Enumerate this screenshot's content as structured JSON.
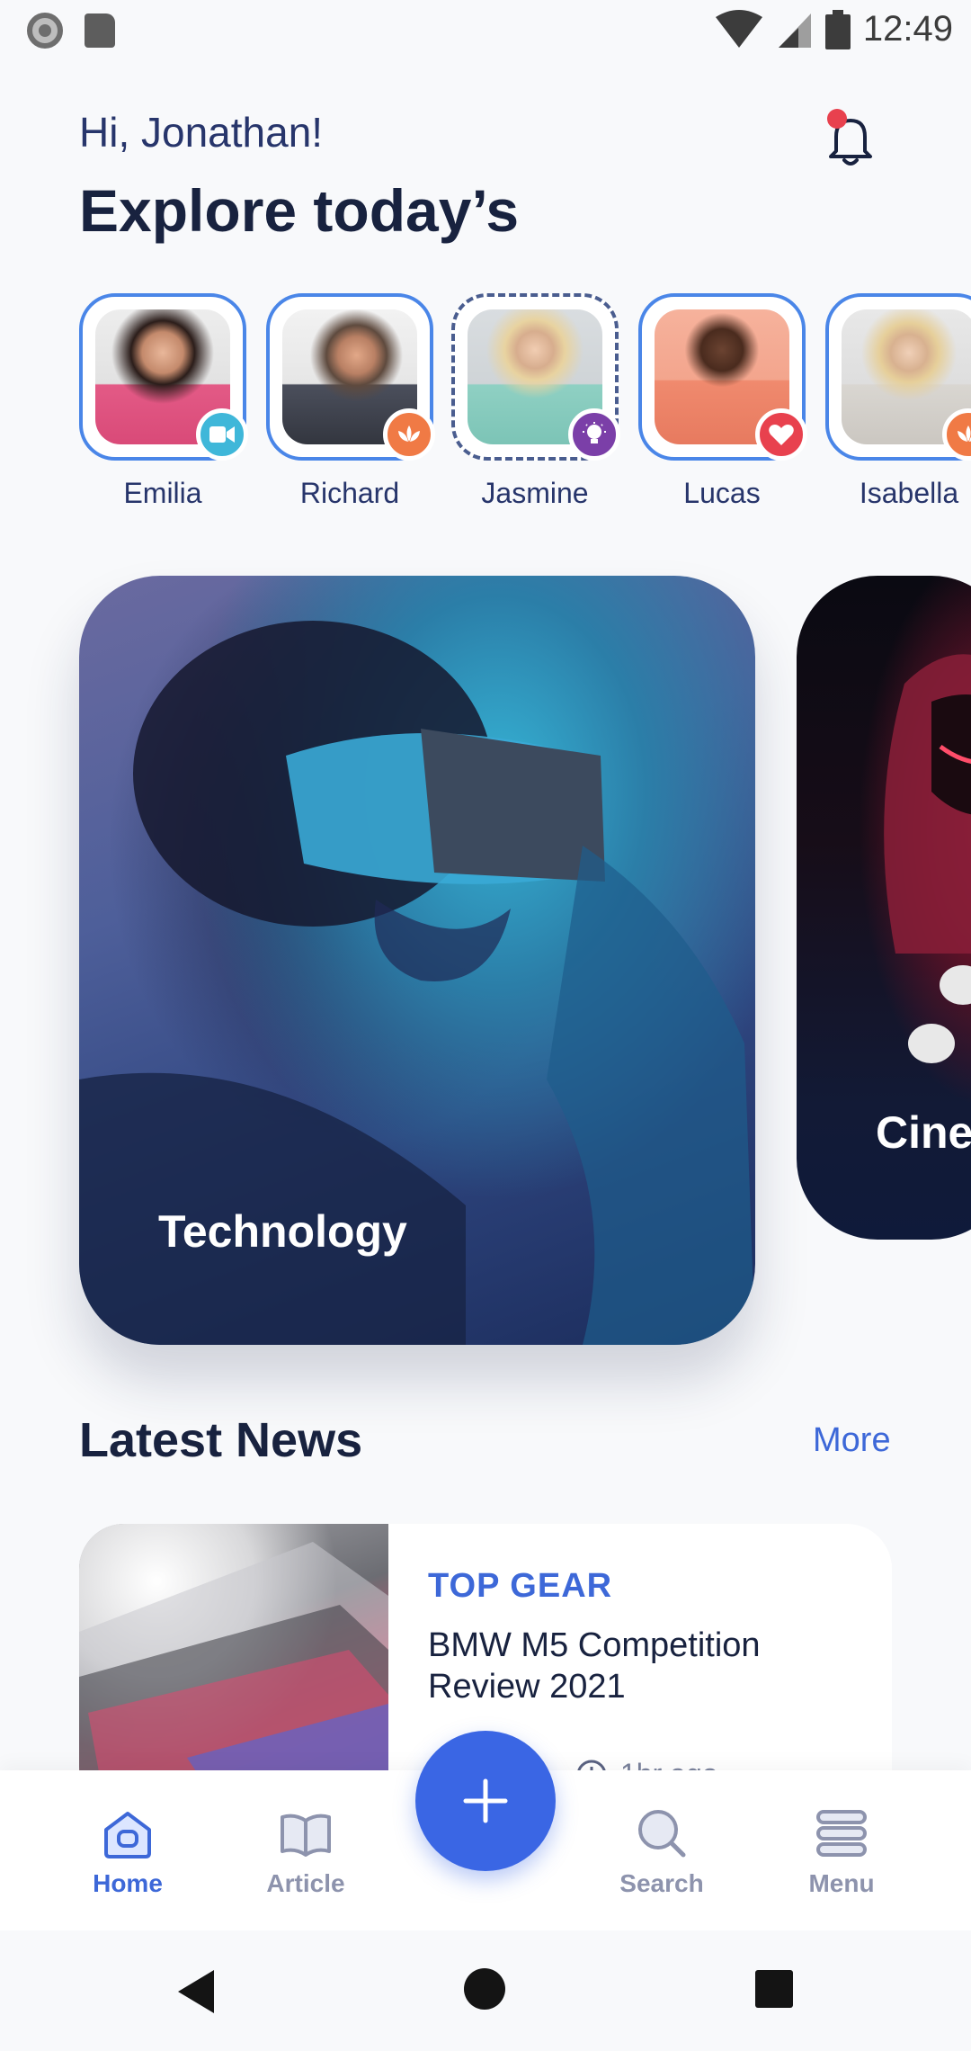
{
  "status_bar": {
    "time": "12:49",
    "icons": [
      "record-icon",
      "sd-card-icon",
      "wifi-icon",
      "signal-icon",
      "battery-icon"
    ]
  },
  "header": {
    "greeting": "Hi, Jonathan!",
    "title": "Explore today’s",
    "notification_icon": "bell-icon",
    "has_unread": true
  },
  "stories": [
    {
      "name": "Emilia",
      "badge": "video-icon",
      "badge_color": "#3fb7d9",
      "ring": "solid",
      "avatar_bg": "#e35a86"
    },
    {
      "name": "Richard",
      "badge": "lotus-icon",
      "badge_color": "#f07a45",
      "ring": "solid",
      "avatar_bg": "#4b4f5c"
    },
    {
      "name": "Jasmine",
      "badge": "lightbulb-icon",
      "badge_color": "#7b3fa8",
      "ring": "dashed",
      "avatar_bg": "#8fd0c3"
    },
    {
      "name": "Lucas",
      "badge": "heart-icon",
      "badge_color": "#e8414e",
      "ring": "solid",
      "avatar_bg": "#f08a6e"
    },
    {
      "name": "Isabella",
      "badge": "lotus-icon",
      "badge_color": "#f07a45",
      "ring": "solid",
      "avatar_bg": "#d9d6d1"
    }
  ],
  "categories": [
    {
      "label": "Technology"
    },
    {
      "label": "Cine"
    }
  ],
  "latest_news": {
    "title": "Latest News",
    "more_label": "More",
    "items": [
      {
        "source": "TOP GEAR",
        "title": "BMW M5 Competition Review 2021",
        "time": "1hr ago"
      }
    ]
  },
  "bottom_nav": {
    "items": [
      {
        "label": "Home",
        "icon": "home-icon",
        "active": true
      },
      {
        "label": "Article",
        "icon": "book-icon",
        "active": false
      },
      {
        "label": "Search",
        "icon": "search-icon",
        "active": false
      },
      {
        "label": "Menu",
        "icon": "menu-icon",
        "active": false
      }
    ],
    "fab_icon": "plus-icon"
  },
  "colors": {
    "accent": "#3a66e4",
    "text_dark": "#18223f",
    "text_muted": "#8d93ad"
  }
}
